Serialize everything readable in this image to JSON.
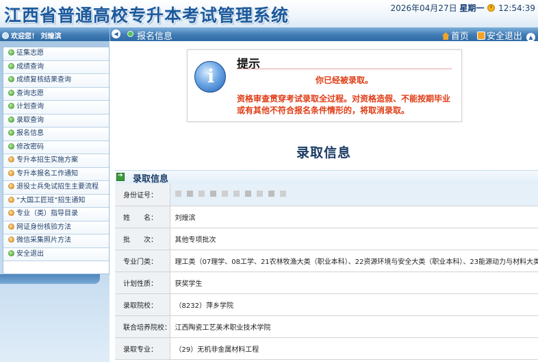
{
  "header": {
    "title": "江西省普通高校专升本考试管理系统",
    "date": "2026年04月27日",
    "weekday": "星期一",
    "time": "12:54:39"
  },
  "navbar": {
    "welcome": "欢迎您！ 刘煌滨",
    "location": "报名信息",
    "home_label": "首页",
    "logout_label": "安全退出"
  },
  "sidebar": {
    "items": [
      {
        "label": "征集志愿",
        "color": "green"
      },
      {
        "label": "成绩查询",
        "color": "green"
      },
      {
        "label": "成绩复核结果查询",
        "color": "green"
      },
      {
        "label": "查询志愿",
        "color": "green"
      },
      {
        "label": "计划查询",
        "color": "green"
      },
      {
        "label": "录取查询",
        "color": "green"
      },
      {
        "label": "报名信息",
        "color": "green"
      },
      {
        "label": "修改密码",
        "color": "green"
      },
      {
        "label": "专升本招生实施方案",
        "color": "orange"
      },
      {
        "label": "专升本报名工作通知",
        "color": "orange"
      },
      {
        "label": "退役士兵免试招生主要流程",
        "color": "orange"
      },
      {
        "label": "“大国工匠班”招生通知",
        "color": "orange"
      },
      {
        "label": "专业（类）指导目录",
        "color": "orange"
      },
      {
        "label": "网证身份核验方法",
        "color": "orange"
      },
      {
        "label": "微信采集照片方法",
        "color": "orange"
      },
      {
        "label": "安全退出",
        "color": "green"
      }
    ]
  },
  "notice": {
    "title": "提示",
    "message": "你已经被录取。",
    "warning": "资格审查贯穿考试录取全过程。对资格造假、不能按期毕业或有其他不符合报名条件情形的，将取消录取。"
  },
  "main": {
    "section_title": "录取信息",
    "panel_title": "录取信息"
  },
  "admission": {
    "rows": [
      {
        "label": "身份证号：",
        "value": ""
      },
      {
        "label": "姓　　名：",
        "value": "刘煌滨"
      },
      {
        "label": "批　　次：",
        "value": "其他专项批次"
      },
      {
        "label": "专业门类：",
        "value": "理工类（07理学、08工学、21农林牧渔大类（职业本科）、22资源环境与安全大类（职业本科）、23能源动力与材料大类（职"
      },
      {
        "label": "计划性质：",
        "value": "获奖学生"
      },
      {
        "label": "录取院校：",
        "value": "（8232）萍乡学院"
      },
      {
        "label": "联合培养院校：",
        "value": "江西陶瓷工艺美术职业技术学院"
      },
      {
        "label": "录取专业：",
        "value": "（29）无机非金属材料工程"
      }
    ]
  },
  "colors": {
    "title_blue": "#1d5a9c",
    "nav_blue": "#3f7bb4",
    "alert_red": "#e03b14",
    "bullet_green": "#3f9f2c",
    "bullet_orange": "#e08a12"
  }
}
